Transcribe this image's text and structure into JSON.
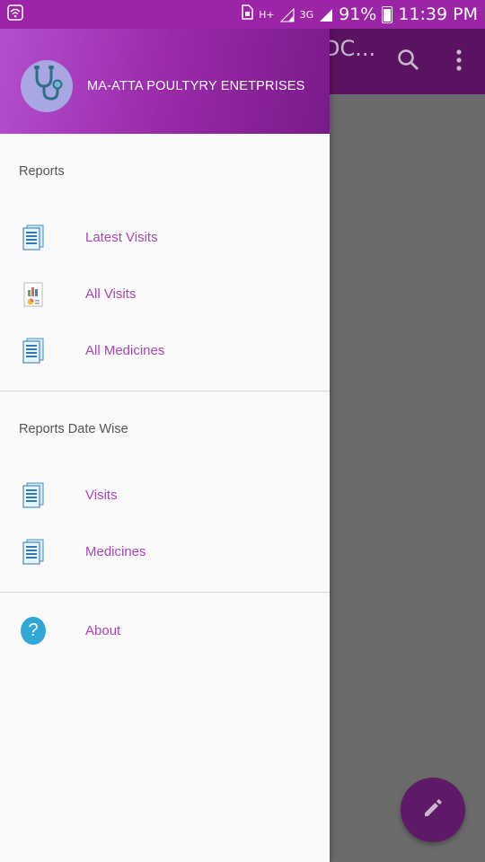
{
  "status_bar": {
    "network_label": "H+",
    "network_3g": "3G",
    "battery": "91%",
    "time": "11:39 PM"
  },
  "app": {
    "title_fragment": "DC..."
  },
  "drawer": {
    "header_name": "MA-ATTA POULTYRY ENETPRISES",
    "sections": [
      {
        "title": "Reports",
        "items": [
          {
            "label": "Latest Visits",
            "icon": "document-icon"
          },
          {
            "label": "All Visits",
            "icon": "report-chart-icon"
          },
          {
            "label": "All Medicines",
            "icon": "document-icon"
          }
        ]
      },
      {
        "title": "Reports Date Wise",
        "items": [
          {
            "label": "Visits",
            "icon": "document-icon"
          },
          {
            "label": "Medicines",
            "icon": "document-icon"
          }
        ]
      }
    ],
    "about": {
      "label": "About",
      "icon": "help-icon",
      "icon_glyph": "?"
    }
  },
  "colors": {
    "primary": "#9b25a6",
    "primary_dark": "#5a1360",
    "accent_text": "#a845b8",
    "scrim": "#6b6b6b",
    "help_icon": "#2fa8d8"
  }
}
